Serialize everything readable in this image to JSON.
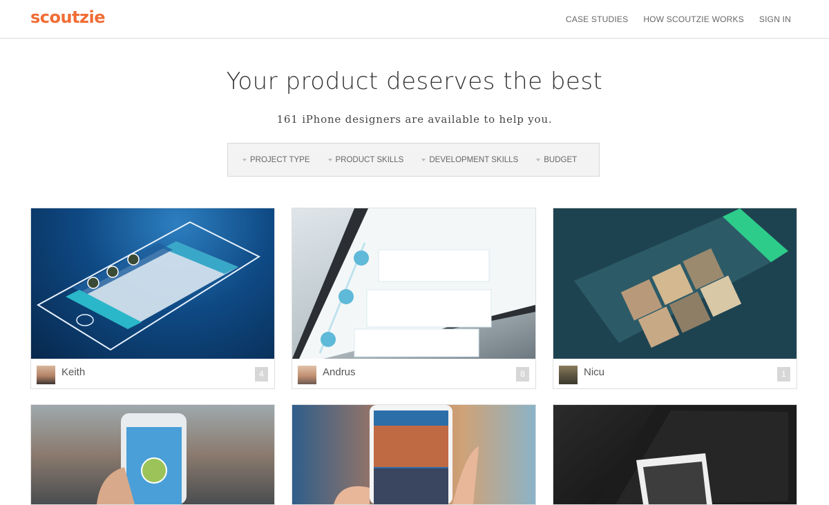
{
  "header": {
    "logo": "scoutzie",
    "nav": [
      "CASE STUDIES",
      "HOW SCOUTZIE WORKS",
      "SIGN IN"
    ]
  },
  "hero": {
    "title": "Your product deserves the best",
    "subtitle": "161 iPhone designers are available to help you."
  },
  "filters": [
    "PROJECT TYPE",
    "PRODUCT SKILLS",
    "DEVELOPMENT SKILLS",
    "BUDGET"
  ],
  "cards": [
    {
      "name": "Keith",
      "count": "4"
    },
    {
      "name": "Andrus",
      "count": "8"
    },
    {
      "name": "Nicu",
      "count": "1"
    }
  ],
  "colors": {
    "brand": "#f06d35",
    "teal": "#2ab7c9",
    "green": "#2ecc8b"
  }
}
